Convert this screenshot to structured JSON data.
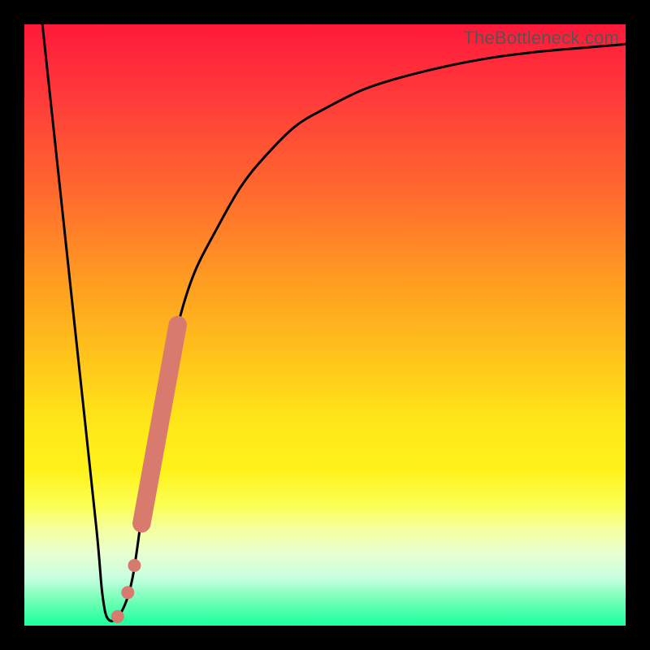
{
  "watermark": "TheBottleneck.com",
  "colors": {
    "page_bg": "#000000",
    "curve": "#000000",
    "marker": "#d97a6f",
    "gradient_top": "#ff1a3a",
    "gradient_bottom": "#1aff9e"
  },
  "chart_data": {
    "type": "line",
    "title": "",
    "xlabel": "",
    "ylabel": "",
    "xlim": [
      0,
      100
    ],
    "ylim": [
      0,
      100
    ],
    "grid": false,
    "legend": false,
    "series": [
      {
        "name": "bottleneck-curve",
        "x": [
          3,
          6,
          9,
          12,
          13,
          14,
          16,
          18,
          20,
          22,
          25,
          28,
          32,
          36,
          40,
          45,
          50,
          56,
          62,
          70,
          78,
          86,
          94,
          100
        ],
        "values": [
          100,
          72,
          44,
          16,
          5,
          1,
          2,
          8,
          22,
          35,
          48,
          58,
          66,
          73,
          78,
          83,
          86,
          89,
          91,
          93,
          94.5,
          95.5,
          96.2,
          96.7
        ]
      }
    ],
    "markers": [
      {
        "name": "highlight-dot-1",
        "x": 15.5,
        "y": 1.5,
        "r": 1.2
      },
      {
        "name": "highlight-dot-2",
        "x": 17.2,
        "y": 5.5,
        "r": 1.2
      },
      {
        "name": "highlight-dot-3",
        "x": 18.3,
        "y": 10.0,
        "r": 1.2
      },
      {
        "name": "highlight-bar-start",
        "x": 19.5,
        "y": 17,
        "r": 1.6
      },
      {
        "name": "highlight-bar-end",
        "x": 25.5,
        "y": 50,
        "r": 1.6
      }
    ]
  }
}
